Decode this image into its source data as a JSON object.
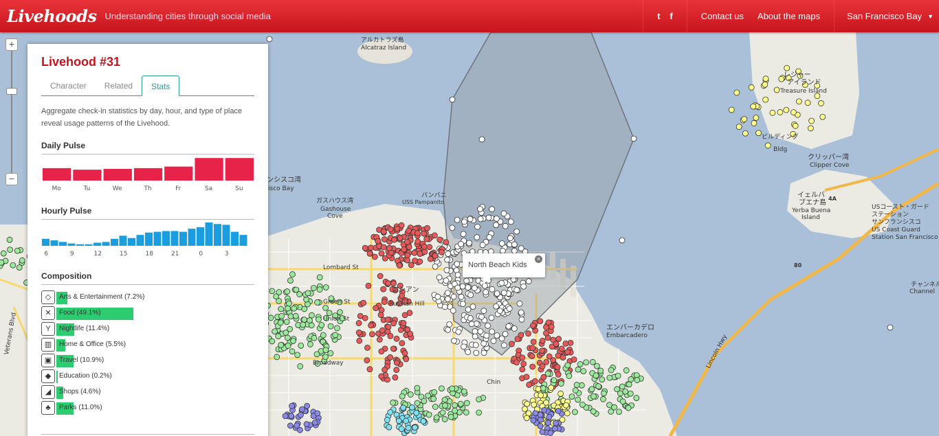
{
  "header": {
    "logo": "Livehoods",
    "tagline": "Understanding cities through social media",
    "social": [
      "t",
      "f"
    ],
    "links": [
      "Contact us",
      "About the maps"
    ],
    "city": "San Francisco Bay"
  },
  "zoom": {
    "plus": "+",
    "minus": "−"
  },
  "panel": {
    "title": "Livehood #31",
    "tabs": [
      "Character",
      "Related",
      "Stats"
    ],
    "active_tab": "Stats",
    "description": "Aggregate check-in statistics by day, hour, and type of place reveal usage patterns of the Livehood.",
    "daily_title": "Daily Pulse",
    "hourly_title": "Hourly Pulse",
    "composition_title": "Composition"
  },
  "popup": {
    "label": "North Beach Kids",
    "close": "×"
  },
  "map_labels": [
    "アルカトラズ島",
    "Alcatraz Island",
    "レジャー",
    "アイランド",
    "Treasure Island",
    "ビルディング",
    "Bldg",
    "クリッパー湾",
    "Clipper Cove",
    "イェルバ",
    "ブエナ島",
    "Yerba Buena",
    "Island",
    "ンシスコ湾",
    "isco Bay",
    "ガスハウス湾",
    "Gashouse",
    "Cove",
    "USコースト・ガード",
    "ステーション",
    "サンフランシスコ",
    "US Coast Guard",
    "Station San Francisco",
    "エンバーカデロ",
    "Embarcadero",
    "ロシアン",
    "Russian Hill",
    "Lincoln Hwy",
    "Veterans Blvd",
    "チャンネル",
    "Channel",
    "Broadway",
    "Chin",
    "バンバニ",
    "USS Pampanito",
    "Green St",
    "Lombard St",
    "Union St",
    "80",
    "4A"
  ],
  "chart_data": [
    {
      "type": "bar",
      "title": "Daily Pulse",
      "categories": [
        "Mo",
        "Tu",
        "We",
        "Th",
        "Fr",
        "Sa",
        "Su"
      ],
      "values": [
        16,
        14,
        15,
        16,
        18,
        29,
        29
      ],
      "color": "#e8234a"
    },
    {
      "type": "bar",
      "title": "Hourly Pulse",
      "categories": [
        "6",
        "7",
        "8",
        "9",
        "10",
        "11",
        "12",
        "13",
        "14",
        "15",
        "16",
        "17",
        "18",
        "19",
        "20",
        "21",
        "22",
        "23",
        "0",
        "1",
        "2",
        "3",
        "4",
        "5"
      ],
      "tick_labels": [
        "6",
        "9",
        "12",
        "15",
        "18",
        "21",
        "0",
        "3"
      ],
      "values": [
        9,
        7,
        5,
        3,
        2,
        2,
        4,
        5,
        9,
        13,
        10,
        14,
        17,
        18,
        19,
        19,
        18,
        22,
        24,
        30,
        28,
        27,
        18,
        14
      ],
      "color": "#1a9ee0"
    },
    {
      "type": "bar",
      "title": "Composition",
      "categories": [
        "Arts & Entertainment",
        "Food",
        "Nightlife",
        "Home & Office",
        "Travel",
        "Education",
        "Shops",
        "Parks"
      ],
      "labels": [
        "Arts & Entertainment  (7.2%)",
        "Food  (49.1%)",
        "Nightlife  (11.4%)",
        "Home & Office  (5.5%)",
        "Travel  (10.9%)",
        "Education  (0.2%)",
        "Shops  (4.6%)",
        "Parks  (11.0%)"
      ],
      "values": [
        7.2,
        49.1,
        11.4,
        5.5,
        10.9,
        0.2,
        4.6,
        11.0
      ],
      "icons": [
        "ticket-icon",
        "fork-knife-icon",
        "cocktail-icon",
        "building-icon",
        "suitcase-icon",
        "graduation-cap-icon",
        "tag-icon",
        "tree-icon"
      ],
      "color": "#2ecc71"
    }
  ]
}
